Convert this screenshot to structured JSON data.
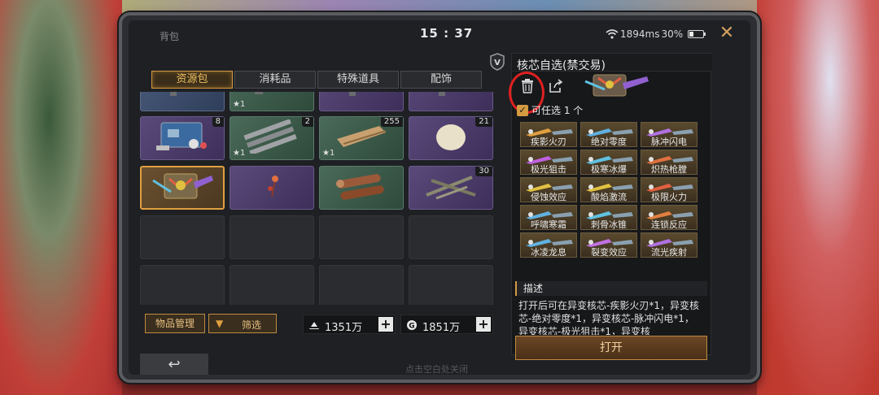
{
  "status": {
    "title": "背包",
    "time": "15 : 37",
    "network": "1894ms",
    "battery": "30%",
    "battery_level": 0.3
  },
  "tabs": [
    {
      "label": "资源包",
      "active": true
    },
    {
      "label": "消耗品",
      "active": false
    },
    {
      "label": "特殊道具",
      "active": false
    },
    {
      "label": "配饰",
      "active": false
    }
  ],
  "grid": {
    "rows": [
      [
        {
          "rarity": "blue",
          "count": "",
          "star": "",
          "icon": "gun-icon"
        },
        {
          "rarity": "green",
          "count": "",
          "star": "★1",
          "icon": "gun-parts-icon"
        },
        {
          "rarity": "purple",
          "count": "",
          "star": "",
          "icon": "gun-icon"
        },
        {
          "rarity": "purple",
          "count": "",
          "star": "",
          "icon": "gun-icon"
        }
      ],
      [
        {
          "rarity": "purple",
          "count": "8",
          "star": "",
          "icon": "supply-box-icon"
        },
        {
          "rarity": "green",
          "count": "2",
          "star": "★1",
          "icon": "gun-barrels-icon"
        },
        {
          "rarity": "green",
          "count": "255",
          "star": "★1",
          "icon": "scroll-icon"
        },
        {
          "rarity": "purple",
          "count": "21",
          "star": "",
          "icon": "egg-icon"
        }
      ],
      [
        {
          "rarity": "selected",
          "count": "",
          "star": "",
          "icon": "core-chest-icon"
        },
        {
          "rarity": "purple",
          "count": "",
          "star": "",
          "icon": "flower-icon"
        },
        {
          "rarity": "green",
          "count": "",
          "star": "",
          "icon": "logs-icon"
        },
        {
          "rarity": "purple",
          "count": "30",
          "star": "",
          "icon": "sticks-icon"
        }
      ],
      [
        {
          "rarity": "empty"
        },
        {
          "rarity": "empty"
        },
        {
          "rarity": "empty"
        },
        {
          "rarity": "empty"
        }
      ],
      [
        {
          "rarity": "empty"
        },
        {
          "rarity": "empty"
        },
        {
          "rarity": "empty"
        },
        {
          "rarity": "empty"
        }
      ]
    ]
  },
  "bottom": {
    "manage_label": "物品管理",
    "filter_label": "筛选",
    "currency1": "1351万",
    "currency2": "1851万",
    "hint": "点击空白处关闭"
  },
  "panel": {
    "title": "核芯自选(禁交易)",
    "select_label": "可任选 1 个",
    "options": [
      {
        "name": "疾影火刃",
        "color": "#e0a040"
      },
      {
        "name": "绝对零度",
        "color": "#60b0e0"
      },
      {
        "name": "脉冲闪电",
        "color": "#b070e0"
      },
      {
        "name": "极光狙击",
        "color": "#c060e0"
      },
      {
        "name": "极寒冰爆",
        "color": "#60c0e0"
      },
      {
        "name": "炽热枪膛",
        "color": "#e07040"
      },
      {
        "name": "侵蚀效应",
        "color": "#e0c040"
      },
      {
        "name": "酸焰激流",
        "color": "#e0c040"
      },
      {
        "name": "极限火力",
        "color": "#e06040"
      },
      {
        "name": "呼啸寒霜",
        "color": "#60b0e0"
      },
      {
        "name": "刺骨冰锥",
        "color": "#60c0e0"
      },
      {
        "name": "连锁反应",
        "color": "#e08040"
      },
      {
        "name": "冰凌龙息",
        "color": "#60b0e0"
      },
      {
        "name": "裂变效应",
        "color": "#c070e0"
      },
      {
        "name": "流光疾射",
        "color": "#b070e0"
      }
    ],
    "desc_head": "描述",
    "desc_text": "打开后可在异变核芯-疾影火刃*1，异变核芯-绝对零度*1，异变核芯-脉冲闪电*1，异变核芯-极光狙击*1，异变核",
    "open_label": "打开"
  }
}
